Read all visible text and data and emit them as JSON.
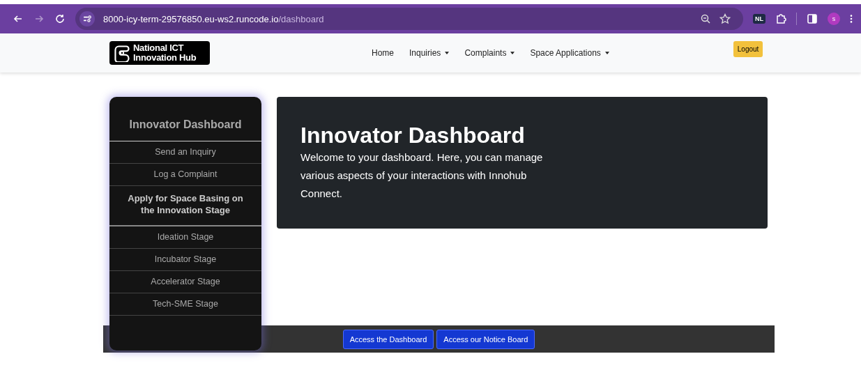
{
  "browser": {
    "url_host": "8000-icy-term-29576850.eu-ws2.runcode.io",
    "url_path": "/dashboard",
    "forward_disabled": true,
    "extension_badge": "NL",
    "profile_initial": "s"
  },
  "navbar": {
    "logo_lines": [
      "National ICT",
      "Innovation Hub"
    ],
    "links": [
      {
        "label": "Home",
        "dropdown": false
      },
      {
        "label": "Inquiries",
        "dropdown": true
      },
      {
        "label": "Complaints",
        "dropdown": true
      },
      {
        "label": "Space Applications",
        "dropdown": true
      }
    ],
    "logout": "Logout"
  },
  "sidebar": {
    "title": "Innovator Dashboard",
    "items": [
      {
        "kind": "link",
        "label": "Send an Inquiry"
      },
      {
        "kind": "link",
        "label": "Log a Complaint"
      },
      {
        "kind": "heading",
        "label": "Apply for Space Basing on the Innovation Stage"
      },
      {
        "kind": "link",
        "label": "Ideation Stage"
      },
      {
        "kind": "link",
        "label": "Incubator Stage"
      },
      {
        "kind": "link",
        "label": "Accelerator Stage"
      },
      {
        "kind": "link",
        "label": "Tech-SME Stage"
      }
    ]
  },
  "hero": {
    "title": "Innovator Dashboard",
    "text": "Welcome to your dashboard. Here, you can manage various aspects of your interactions with Innohub Connect."
  },
  "footer": {
    "buttons": [
      "Access the Dashboard",
      "Access our Notice Board"
    ]
  }
}
